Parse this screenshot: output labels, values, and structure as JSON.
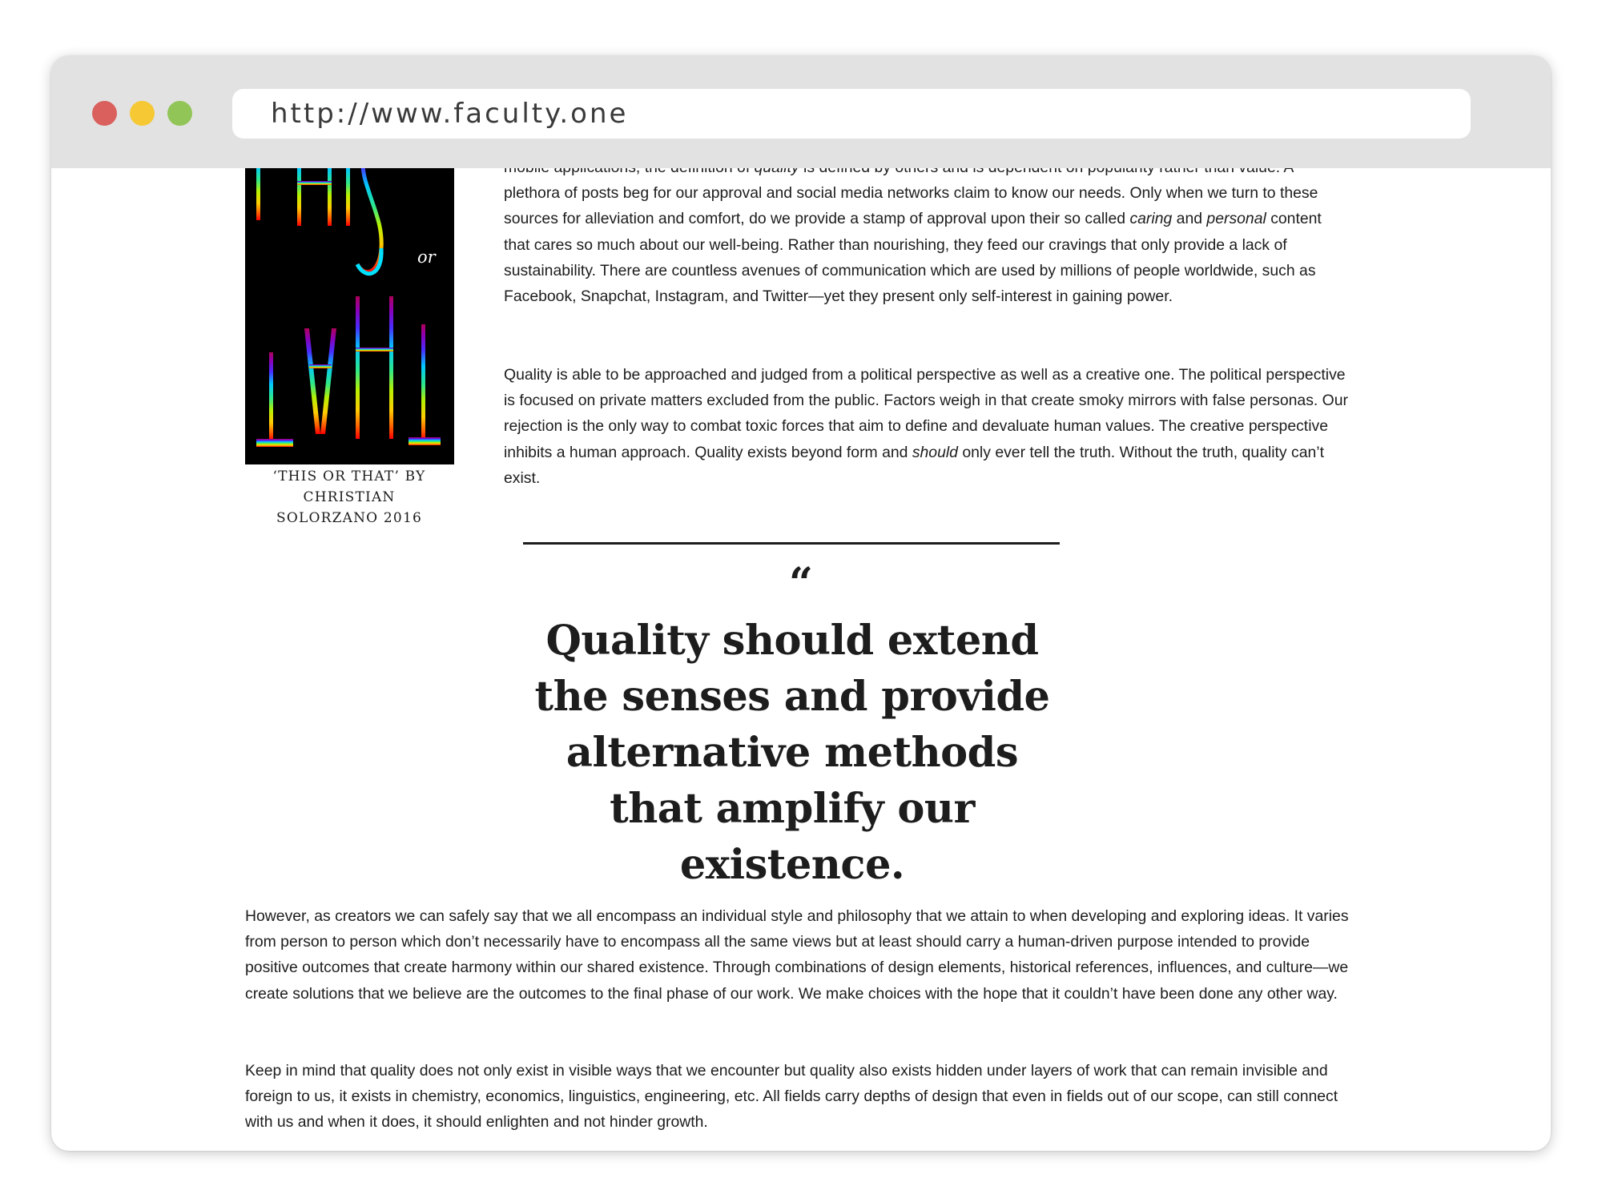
{
  "browser": {
    "url": "http://www.faculty.one"
  },
  "figure": {
    "poster_word_top": "THIS",
    "poster_word_mid": "or",
    "poster_word_bottom": "THAT",
    "caption_line1": "‘THIS OR THAT’ BY CHRISTIAN",
    "caption_line2": "SOLORZANO 2016"
  },
  "article": {
    "p1": {
      "s1": "mobile applications, the definition of ",
      "s1_em": "quality",
      "s2": " is defined by others and is dependent on popularity rather than value. A plethora of posts beg for our approval and social media networks claim to know our needs. Only when we turn to these sources for alleviation and comfort, do we provide a stamp of approval upon their so called ",
      "s2_em1": "caring",
      "s3": " and ",
      "s3_em": "personal",
      "s4": " content that cares so much about our well-being. Rather than nourishing, they feed our cravings that only provide a lack of sustainability. There are countless avenues of communication which are used by millions of people worldwide, such as Facebook, Snapchat, Instagram, and Twitter—yet they present only self-interest in gaining power."
    },
    "p2": {
      "s1": "Quality is able to be approached and judged from a political perspective as well as a creative one. The political perspective is focused on private matters excluded from the public. Factors weigh in that create smoky mirrors with false personas. Our rejection is the only way to combat toxic forces that aim to define and devaluate human values. The creative perspective inhibits a human approach. Quality exists beyond form and ",
      "s1_em": "should",
      "s2": " only ever tell the truth. Without the truth, quality can’t exist."
    },
    "quote_mark": "“",
    "pull_quote": "Quality should extend the senses and provide alternative methods that amplify our existence.",
    "p3": "However, as creators we can safely say that we all encompass an individual style and philosophy that we attain to when developing and exploring ideas. It varies from person to person which don’t necessarily have to encompass all the same views but at least should carry a human-driven purpose intended to provide positive outcomes that create harmony within our shared existence. Through combinations of design elements, historical references, influences, and culture—we create solutions that we believe are the outcomes to the final phase of our work. We make choices with the hope that it couldn’t have been done any other way.",
    "p4": "Keep in mind that quality does not only exist in visible ways that we encounter but quality also exists hidden under layers of work that can remain invisible and foreign to us, it exists in chemistry, economics, linguistics, engineering, etc. All fields carry depths of design that even in fields out of our scope, can still connect with us and when it does,  it should enlighten and not hinder growth."
  }
}
